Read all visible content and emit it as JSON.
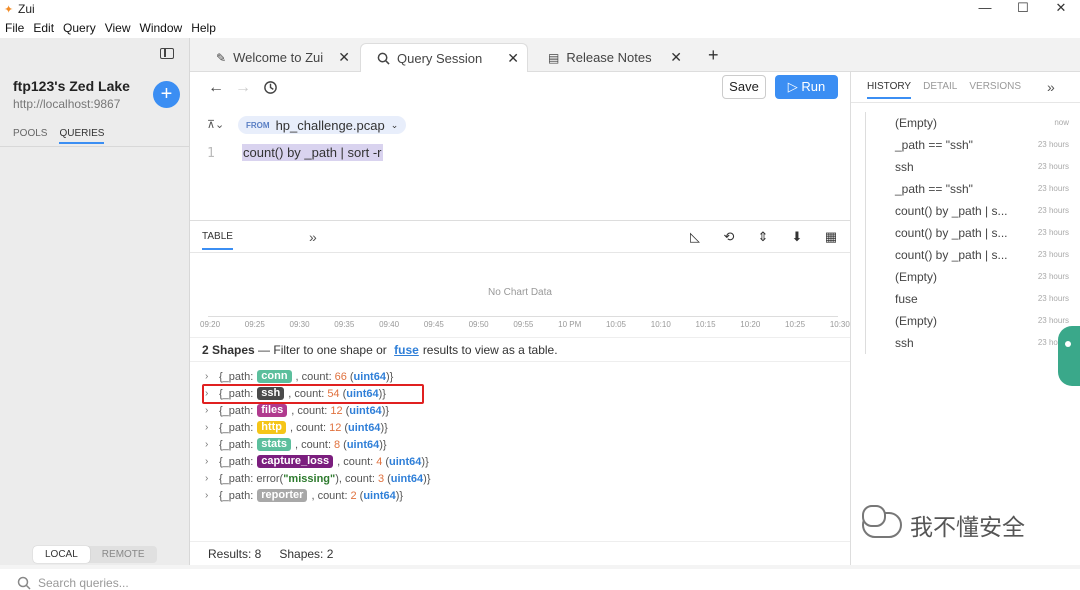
{
  "window": {
    "title": "Zui",
    "minimize": "—",
    "maximize": "☐",
    "close": "✕"
  },
  "menu": [
    "File",
    "Edit",
    "Query",
    "View",
    "Window",
    "Help"
  ],
  "sidebar": {
    "lake_name": "ftp123's Zed Lake",
    "lake_url": "http://localhost:9867",
    "tabs": [
      "POOLS",
      "QUERIES"
    ],
    "location_tabs": [
      "LOCAL",
      "REMOTE"
    ],
    "search_placeholder": "Search queries..."
  },
  "tabs": [
    {
      "label": "Welcome to Zui"
    },
    {
      "label": "Query Session"
    },
    {
      "label": "Release Notes"
    }
  ],
  "toolbar": {
    "save_label": "Save",
    "run_label": "Run"
  },
  "editor": {
    "from_keyword": "FROM",
    "pool": "hp_challenge.pcap",
    "line_number": "1",
    "query": "count() by _path | sort -r"
  },
  "results": {
    "tab_label": "TABLE",
    "no_chart": "No Chart Data",
    "ticks": [
      "09:20",
      "09:25",
      "09:30",
      "09:35",
      "09:40",
      "09:45",
      "09:50",
      "09:55",
      "10 PM",
      "10:05",
      "10:10",
      "10:15",
      "10:20",
      "10:25",
      "10:30"
    ],
    "shapes_bold": "2 Shapes",
    "shapes_text_a": "— Filter to one shape or",
    "shapes_fuse": "fuse",
    "shapes_text_b": "results to view as a table.",
    "rows": [
      {
        "prefix": "{_path:",
        "path": "conn",
        "color": "#5cbf9d",
        "count": "66",
        "type": "uint64"
      },
      {
        "prefix": "{_path:",
        "path": "ssh",
        "color": "#4a4a4a",
        "count": "54",
        "type": "uint64"
      },
      {
        "prefix": "{_path:",
        "path": "files",
        "color": "#b03a8e",
        "count": "12",
        "type": "uint64"
      },
      {
        "prefix": "{_path:",
        "path": "http",
        "color": "#f5c518",
        "count": "12",
        "type": "uint64"
      },
      {
        "prefix": "{_path:",
        "path": "stats",
        "color": "#5cbf9d",
        "count": "8",
        "type": "uint64"
      },
      {
        "prefix": "{_path:",
        "path": "capture_loss",
        "color": "#7b1e7e",
        "count": "4",
        "type": "uint64"
      },
      {
        "prefix": "{_path:",
        "error": "error(",
        "missing": "\"missing\"",
        "error_close": ")",
        "count": "3",
        "type": "uint64"
      },
      {
        "prefix": "{_path:",
        "path": "reporter",
        "color": "#a8a8a8",
        "count": "2",
        "type": "uint64"
      }
    ],
    "status_results": "Results: 8",
    "status_shapes": "Shapes: 2"
  },
  "right_panel": {
    "tabs": [
      "HISTORY",
      "DETAIL",
      "VERSIONS"
    ],
    "history": [
      {
        "text": "(Empty)",
        "time": "now"
      },
      {
        "text": "_path == \"ssh\"",
        "time": "23 hours"
      },
      {
        "text": "ssh",
        "time": "23 hours"
      },
      {
        "text": "_path == \"ssh\"",
        "time": "23 hours"
      },
      {
        "text": "count() by _path | s...",
        "time": "23 hours"
      },
      {
        "text": "count() by _path | s...",
        "time": "23 hours"
      },
      {
        "text": "count() by _path | s...",
        "time": "23 hours"
      },
      {
        "text": "(Empty)",
        "time": "23 hours"
      },
      {
        "text": "fuse",
        "time": "23 hours"
      },
      {
        "text": "(Empty)",
        "time": "23 hours"
      },
      {
        "text": "ssh",
        "time": "23 hours"
      }
    ]
  },
  "watermark": "我不懂安全"
}
